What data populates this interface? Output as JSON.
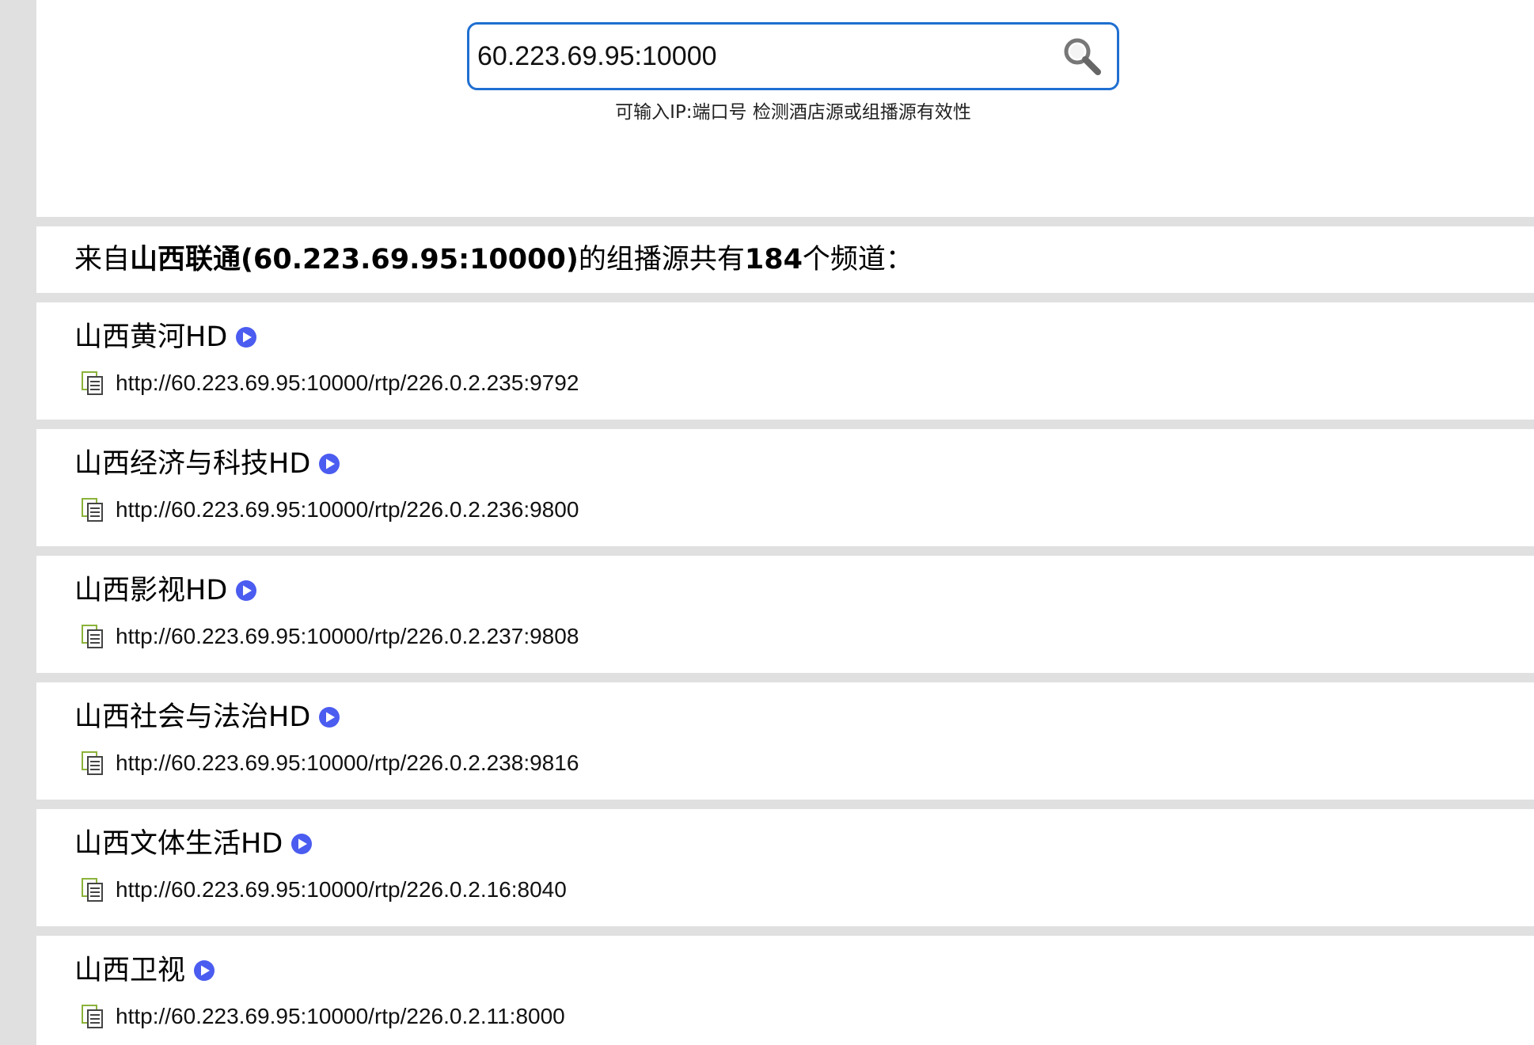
{
  "search": {
    "value": "60.223.69.95:10000",
    "hint": "可输入IP:端口号 检测酒店源或组播源有效性"
  },
  "summary": {
    "prefix": "来自",
    "source": "山西联通(60.223.69.95:10000)",
    "middle": "的组播源共有",
    "count": "184",
    "suffix": "个频道："
  },
  "channels": [
    {
      "name": "山西黄河HD",
      "url": "http://60.223.69.95:10000/rtp/226.0.2.235:9792"
    },
    {
      "name": "山西经济与科技HD",
      "url": "http://60.223.69.95:10000/rtp/226.0.2.236:9800"
    },
    {
      "name": "山西影视HD",
      "url": "http://60.223.69.95:10000/rtp/226.0.2.237:9808"
    },
    {
      "name": "山西社会与法治HD",
      "url": "http://60.223.69.95:10000/rtp/226.0.2.238:9816"
    },
    {
      "name": "山西文体生活HD",
      "url": "http://60.223.69.95:10000/rtp/226.0.2.16:8040"
    },
    {
      "name": "山西卫视",
      "url": "http://60.223.69.95:10000/rtp/226.0.2.11:8000"
    }
  ],
  "colors": {
    "search_border": "#1f6fd1",
    "play_icon": "#4b5cf0",
    "separator": "#e0e0e0",
    "doc_icon_accent": "#8bb33a"
  },
  "icons": {
    "search": "search-icon",
    "play": "play-icon",
    "copy": "document-copy-icon"
  }
}
